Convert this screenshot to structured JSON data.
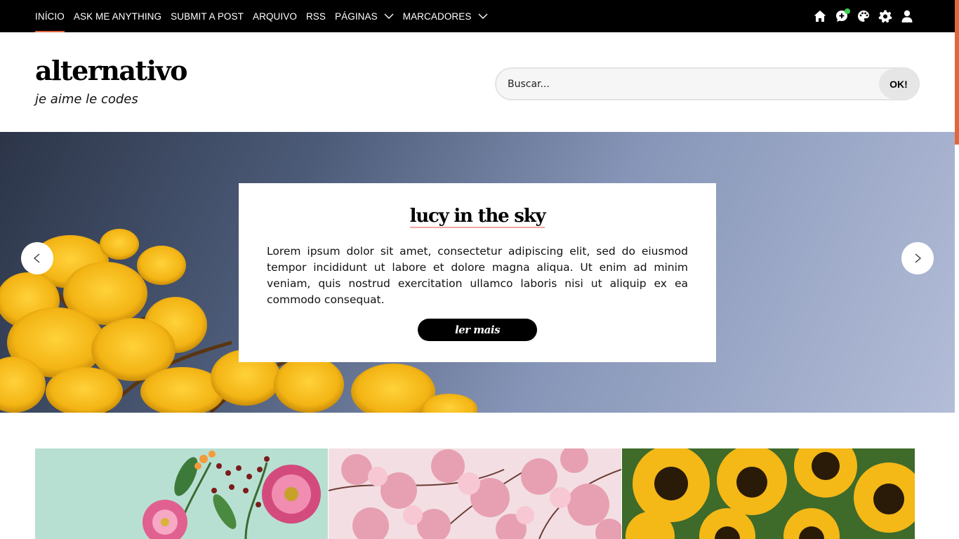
{
  "nav": {
    "items": [
      {
        "label": "Início"
      },
      {
        "label": "Ask me anything"
      },
      {
        "label": "Submit a post"
      },
      {
        "label": "Arquivo"
      },
      {
        "label": "RSS"
      },
      {
        "label": "Páginas"
      },
      {
        "label": "Marcadores"
      }
    ],
    "accent_color": "#e0673d",
    "icons": [
      "home-icon",
      "chat-plus-icon",
      "palette-icon",
      "gear-icon",
      "user-icon"
    ]
  },
  "header": {
    "title": "alternativo",
    "description": "je aime le codes"
  },
  "search": {
    "placeholder": "Buscar...",
    "button_label": "OK!"
  },
  "slider": {
    "title": "lucy in the sky",
    "text": "Lorem ipsum dolor sit amet, consectetur adipiscing elit, sed do eiusmod tempor incididunt ut labore et dolore magna aliqua. Ut enim ad minim veniam, quis nostrud exercitation ullamco laboris nisi ut aliquip ex ea commodo consequat.",
    "button_label": "ler mais",
    "prev_icon": "chevron-left-icon",
    "next_icon": "chevron-right-icon"
  }
}
